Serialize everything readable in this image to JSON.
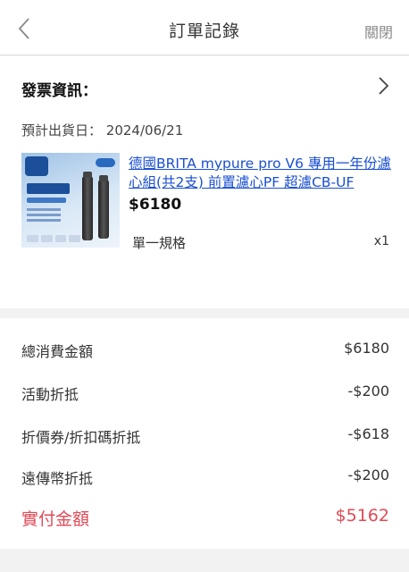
{
  "header": {
    "title": "訂單記錄",
    "close_label": "關閉"
  },
  "invoice": {
    "title": "發票資訊："
  },
  "shipping": {
    "estimated_label": "預計出貨日：",
    "estimated_date": "2024/06/21"
  },
  "product": {
    "name": "德國BRITA mypure pro V6 專用一年份濾心組(共2支) 前置濾心PF 超濾CB-UF",
    "price": "$6180",
    "spec": "單一規格",
    "quantity": "x1"
  },
  "summary": {
    "rows": [
      {
        "label": "總消費金額",
        "value": "$6180"
      },
      {
        "label": "活動折抵",
        "value": "-$200"
      },
      {
        "label": "折價券/折扣碼折抵",
        "value": "-$618"
      },
      {
        "label": "遠傳幣折抵",
        "value": "-$200"
      }
    ],
    "total": {
      "label": "實付金額",
      "value": "$5162"
    }
  },
  "colors": {
    "link": "#1a4fd0",
    "total": "#e04a57",
    "divider_bg": "#f2f2f2"
  }
}
